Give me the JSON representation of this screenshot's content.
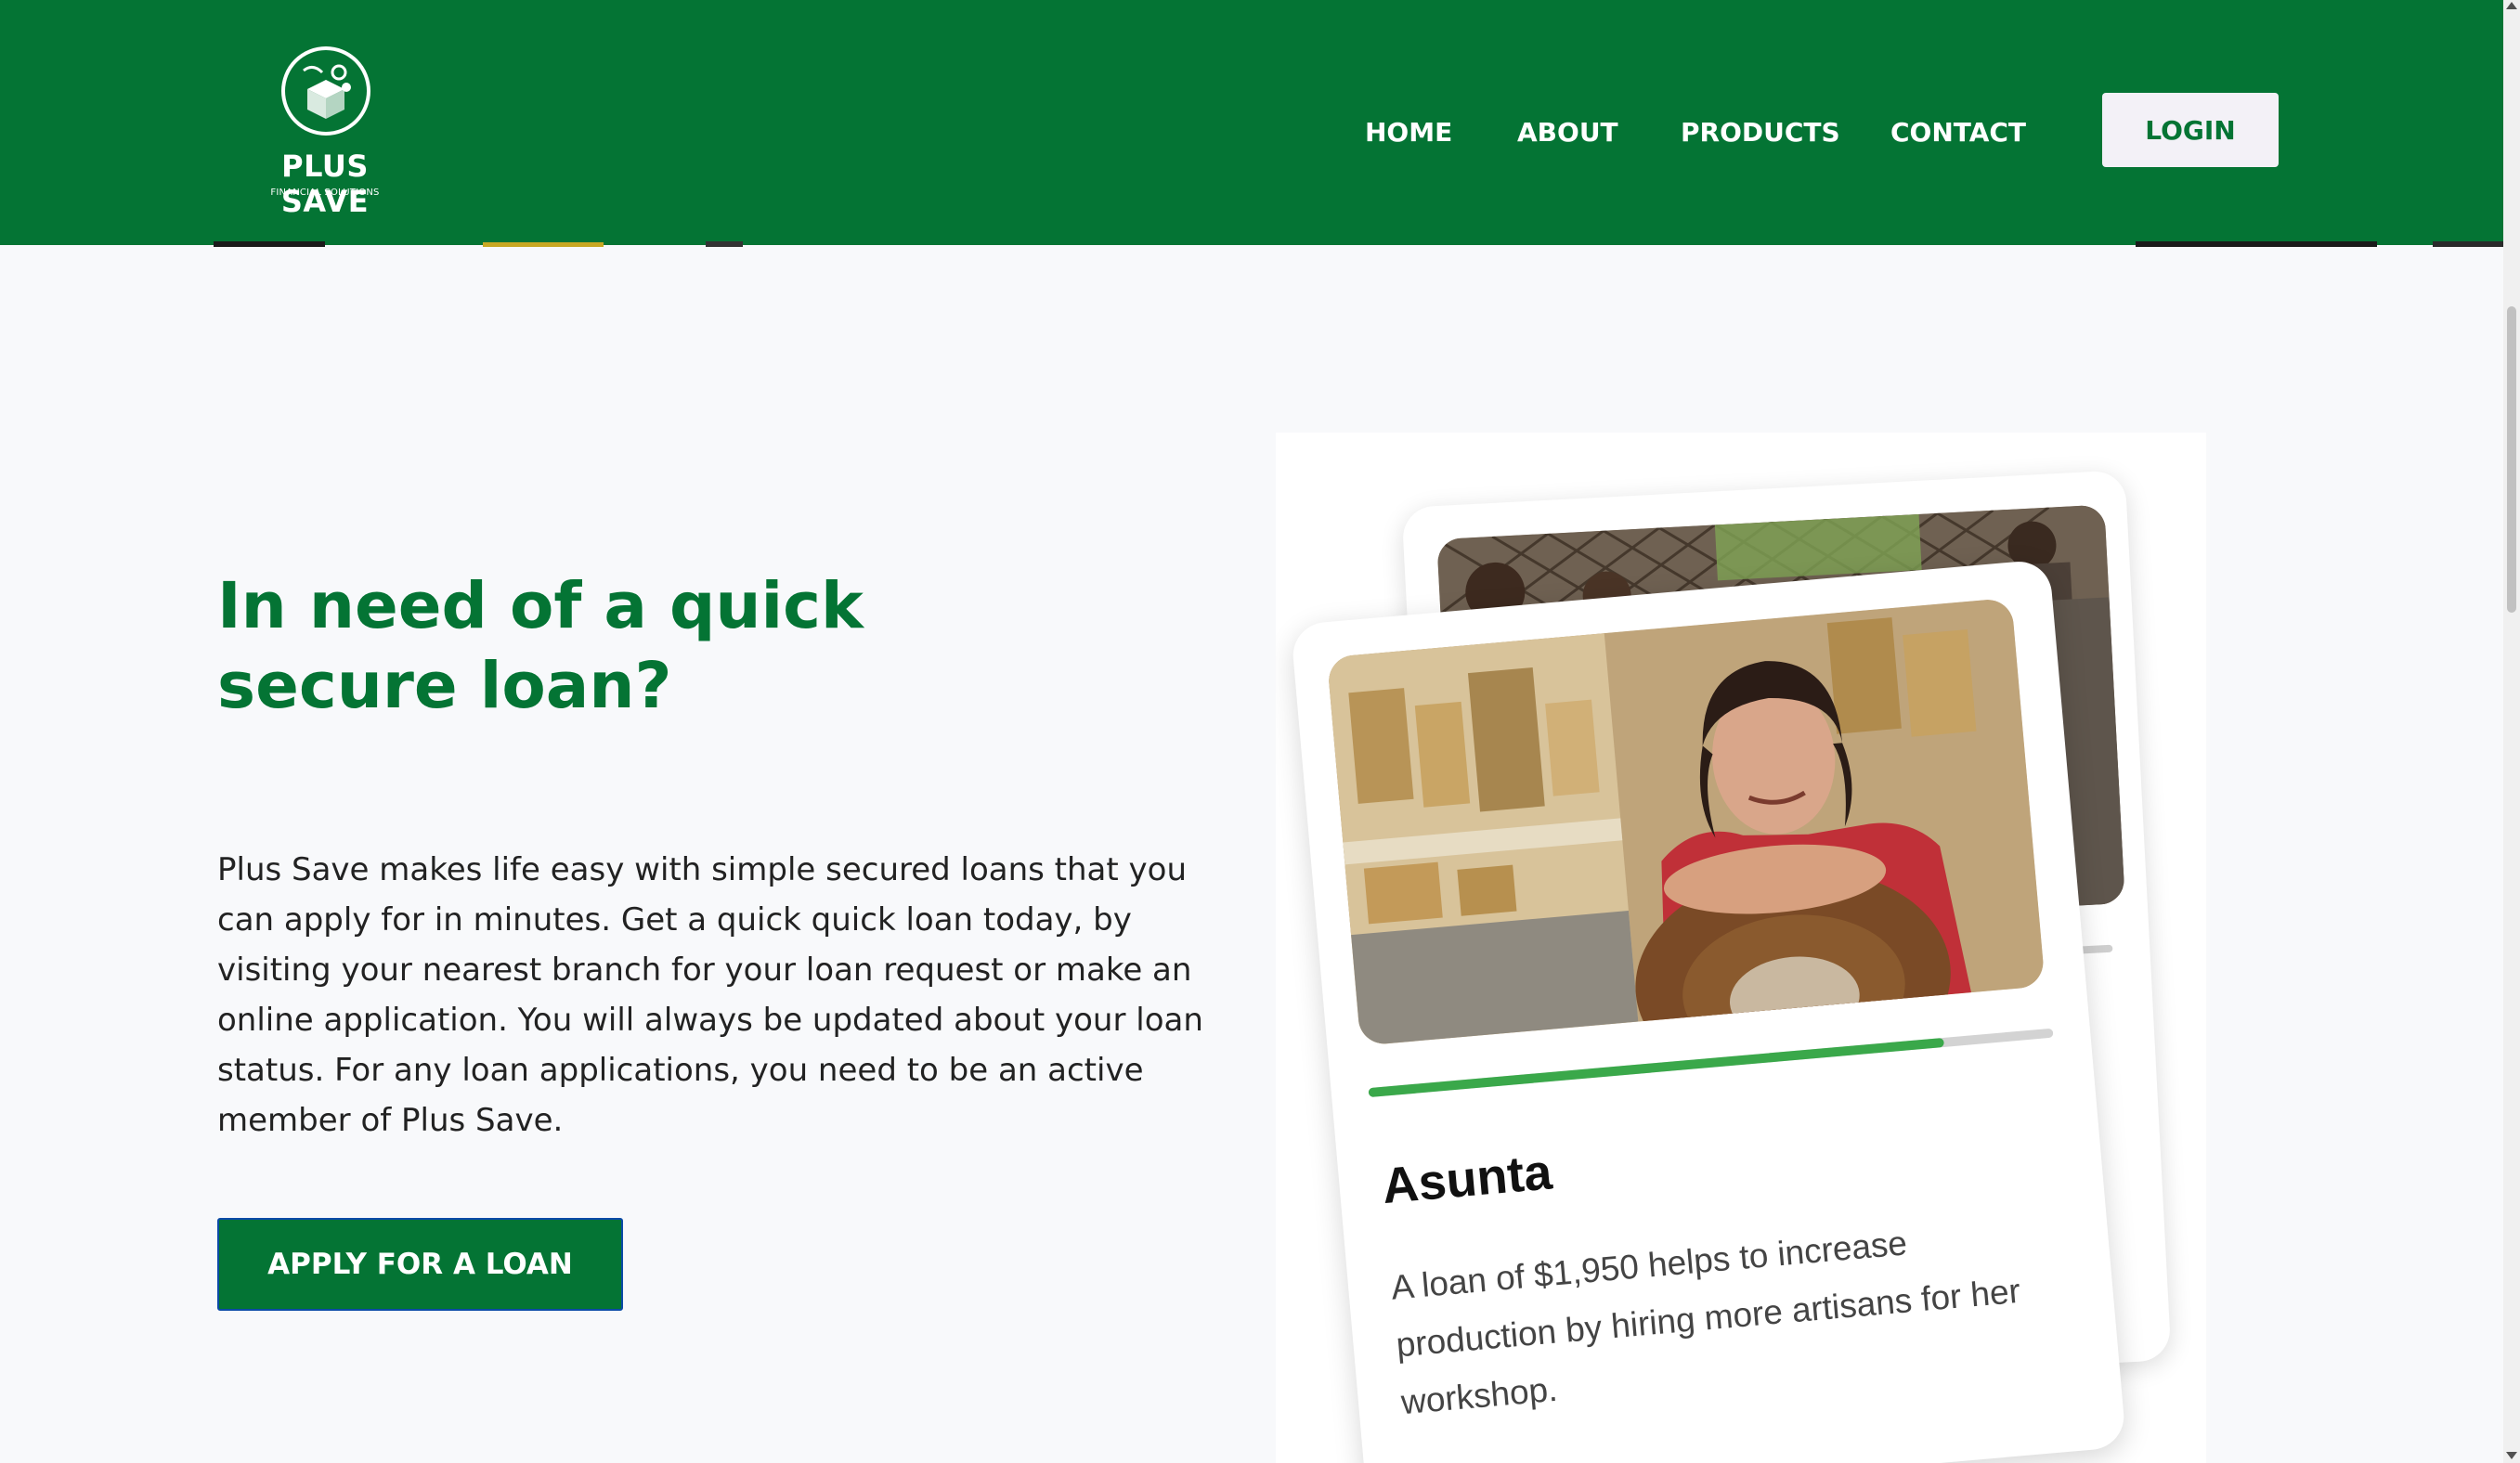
{
  "header": {
    "logo_title": "PLUS SAVE",
    "logo_subtitle": "FINANCIAL SOLUTIONS",
    "nav": [
      "HOME",
      "ABOUT",
      "PRODUCTS",
      "CONTACT"
    ],
    "login_label": "LOGIN",
    "background_color": "#047434"
  },
  "hero": {
    "title": "In need of a quick secure loan?",
    "body": "Plus Save makes life easy with simple secured loans that you can apply for in minutes. Get a quick quick loan today, by visiting your nearest branch for your loan request or make an online application. You will always be updated about your loan status. For any loan applications, you need to be an active member of Plus Save.",
    "cta_label": "APPLY FOR A LOAN"
  },
  "showcase": {
    "card": {
      "name": "Asunta",
      "description": "A loan of $1,950 helps to increase production by hiring more artisans for her workshop.",
      "funded_fraction": 0.84,
      "progress_color": "#3aa84a"
    }
  }
}
